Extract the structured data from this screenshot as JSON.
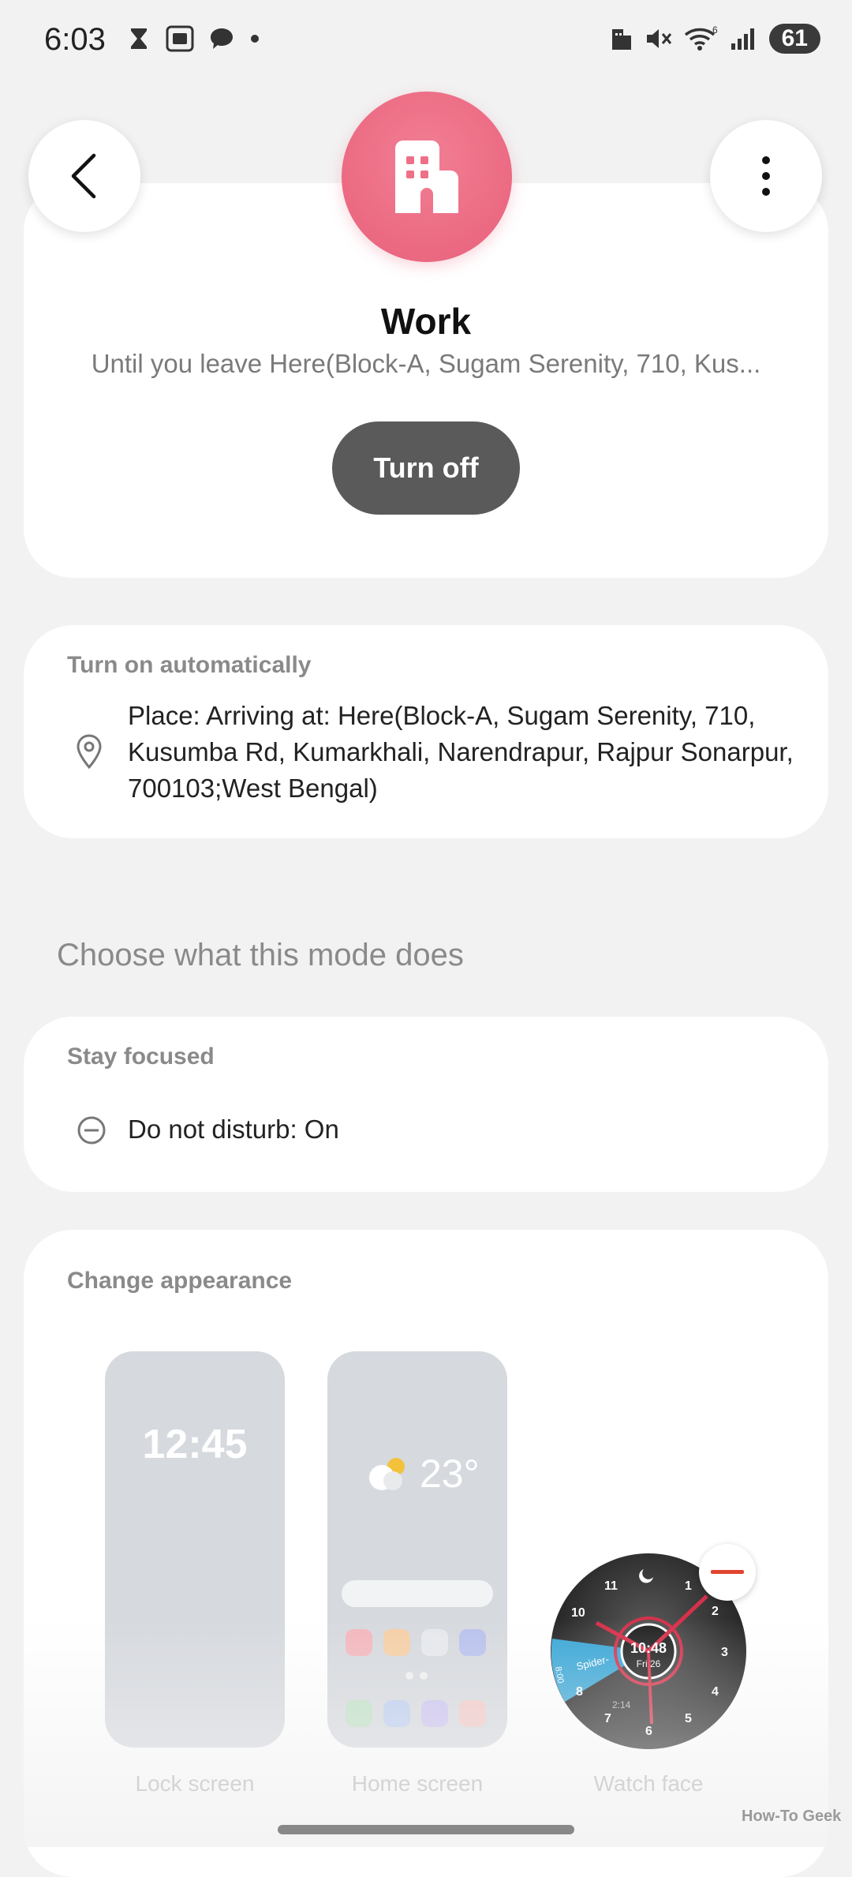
{
  "status_bar": {
    "time": "6:03",
    "battery": "61",
    "left_icons": [
      "hourglass-icon",
      "image-icon",
      "chat-icon",
      "dot-icon"
    ],
    "right_icons": [
      "building-icon",
      "mute-icon",
      "wifi-icon",
      "signal-icon"
    ]
  },
  "mode": {
    "title": "Work",
    "subtitle": "Until you leave Here(Block-A, Sugam Serenity, 710, Kus...",
    "turn_off_label": "Turn off",
    "accent_color": "#e8607a"
  },
  "auto": {
    "label": "Turn on automatically",
    "text": "Place: Arriving at: Here(Block-A, Sugam Serenity, 710, Kusumba Rd, Kumarkhali, Narendrapur, Rajpur Sonarpur, 700103;West Bengal)"
  },
  "choose_heading": "Choose what this mode does",
  "focus": {
    "label": "Stay focused",
    "dnd_text": "Do not disturb: On"
  },
  "appearance": {
    "label": "Change appearance",
    "lock_time": "12:45",
    "home_temp": "23°",
    "lock_label": "Lock screen",
    "home_label": "Home screen",
    "watch_label": "Watch face"
  },
  "watch": {
    "numbers": [
      "11",
      "1",
      "2",
      "3",
      "4",
      "5",
      "6",
      "7",
      "8",
      "10"
    ],
    "center_time": "10:48",
    "center_date": "Fri 26",
    "wedge_text": "Spider-",
    "wedge_time": "8:00",
    "small_time": "2:14"
  },
  "watermark": "How-To Geek"
}
